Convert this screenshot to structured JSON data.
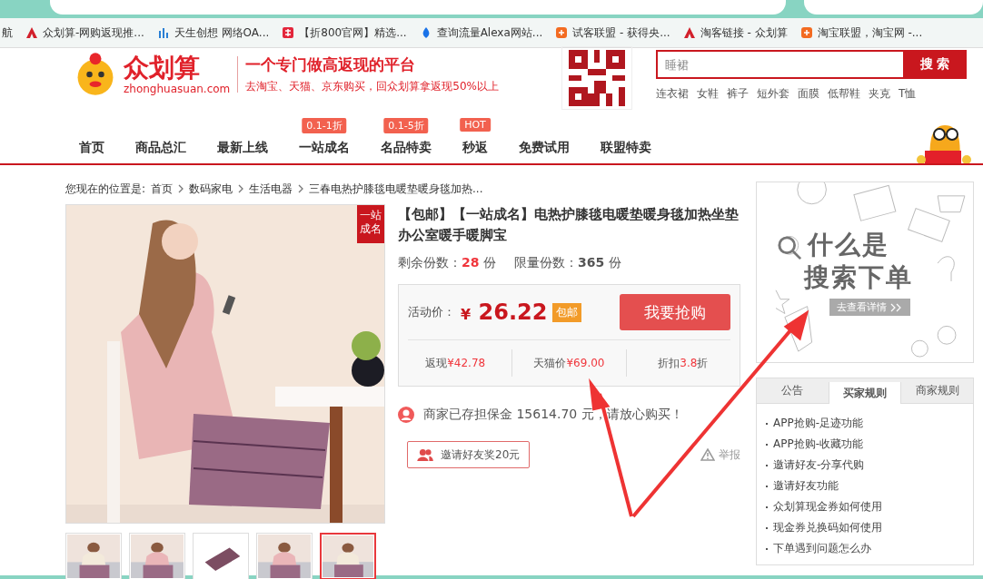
{
  "bookmarks": [
    {
      "label": "航",
      "kind": "none"
    },
    {
      "label": "众划算-网购返现推...",
      "kind": "logo"
    },
    {
      "label": "天生创想 网络OA...",
      "kind": "bars"
    },
    {
      "label": "【折800官网】精选...",
      "kind": "square"
    },
    {
      "label": "查询流量Alexa网站...",
      "kind": "blue"
    },
    {
      "label": "试客联盟 - 获得央...",
      "kind": "orange"
    },
    {
      "label": "淘客链接 - 众划算",
      "kind": "logo"
    },
    {
      "label": "淘宝联盟，淘宝网 -...",
      "kind": "orange"
    }
  ],
  "header": {
    "brand": "众划算",
    "domain": "zhonghuasuan.com",
    "slogan": "一个专门做高返现的平台",
    "subslogan": "去淘宝、天猫、京东购买，回众划算拿返现50%以上"
  },
  "search": {
    "placeholder": "睡裙",
    "button": "搜 索",
    "hot_words": [
      "连衣裙",
      "女鞋",
      "裤子",
      "短外套",
      "面膜",
      "低帮鞋",
      "夹克",
      "T恤"
    ]
  },
  "nav": [
    {
      "label": "首页"
    },
    {
      "label": "商品总汇"
    },
    {
      "label": "最新上线"
    },
    {
      "label": "一站成名",
      "badge": "0.1-1折"
    },
    {
      "label": "名品特卖",
      "badge": "0.1-5折"
    },
    {
      "label": "秒返",
      "badge": "HOT"
    },
    {
      "label": "免费试用"
    },
    {
      "label": "联盟特卖"
    }
  ],
  "breadcrumb": {
    "label": "您现在的位置是:",
    "items": [
      "首页",
      "数码家电",
      "生活电器",
      "三春电热护膝毯电暖垫暖身毯加热..."
    ]
  },
  "product": {
    "corner_badge": "一站成名",
    "thumbnails": [
      {
        "selected": false
      },
      {
        "selected": false
      },
      {
        "selected": false
      },
      {
        "selected": false
      },
      {
        "selected": true
      }
    ],
    "title": "【包邮】【一站成名】电热护膝毯电暖垫暖身毯加热坐垫办公室暖手暖脚宝",
    "stock": [
      {
        "label": "剩余份数：",
        "value": "28",
        "unit": "份",
        "kind": "remaining"
      },
      {
        "label": "限量份数：",
        "value": "365",
        "unit": "份",
        "kind": "limit"
      }
    ],
    "price_label": "活动价：",
    "currency": "¥",
    "price": "26.22",
    "price_tag": "包邮",
    "buy_button": "我要抢购",
    "stats": [
      {
        "label": "返现",
        "value": "¥42.78"
      },
      {
        "label": "天猫价",
        "value": "¥69.00"
      },
      {
        "label": "折扣",
        "value": "3.8",
        "suffix": "折"
      }
    ],
    "deposit": "商家已存担保金 15614.70 元，请放心购买！",
    "invite_button": "邀请好友奖20元",
    "report": "举报"
  },
  "banner": {
    "line1": "什么是",
    "line2": "搜索下单",
    "button": "去查看详情"
  },
  "rules": {
    "tabs": [
      {
        "label": "公告",
        "selected": false
      },
      {
        "label": "买家规则",
        "selected": true
      },
      {
        "label": "商家规则",
        "selected": false
      }
    ],
    "items": [
      "APP抢购-足迹功能",
      "APP抢购-收藏功能",
      "邀请好友-分享代购",
      "邀请好友功能",
      "众划算现金券如何使用",
      "现金券兑换码如何使用",
      "下单遇到问题怎么办"
    ]
  }
}
